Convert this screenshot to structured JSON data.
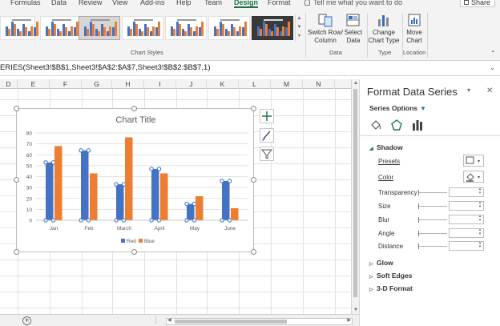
{
  "ribbon": {
    "tabs": [
      {
        "label": "Formulas",
        "active": false
      },
      {
        "label": "Data",
        "active": false
      },
      {
        "label": "Review",
        "active": false
      },
      {
        "label": "View",
        "active": false
      },
      {
        "label": "Add-ins",
        "active": false
      },
      {
        "label": "Help",
        "active": false
      },
      {
        "label": "Team",
        "active": false
      },
      {
        "label": "Design",
        "active": true
      },
      {
        "label": "Format",
        "active": false
      }
    ],
    "tell_me": "Tell me what you want to do",
    "share": "Share",
    "chart_styles_label": "Chart Styles",
    "data_group_label": "Data",
    "type_group_label": "Type",
    "location_group_label": "Location",
    "switch_row_column": [
      "Switch Row/",
      "Column"
    ],
    "select_data": [
      "Select",
      "Data"
    ],
    "change_chart_type": [
      "Change",
      "Chart Type"
    ],
    "move_chart": [
      "Move",
      "Chart"
    ]
  },
  "formula_bar": {
    "formula": "ERIES(Sheet3!$B$1,Sheet3!$A$2:$A$7,Sheet3!$B$2:$B$7,1)"
  },
  "columns": [
    "D",
    "E",
    "F",
    "G",
    "H",
    "I",
    "J",
    "K",
    "L",
    "M",
    "N"
  ],
  "colors": {
    "accent": "#217346",
    "series_red": "#4472c4",
    "series_blue": "#ed7d31",
    "selection_blue": "#2f6fc6"
  },
  "chart_data": {
    "type": "bar",
    "title": "Chart Title",
    "categories": [
      "Jan",
      "Feb",
      "March",
      "April",
      "May",
      "June"
    ],
    "series": [
      {
        "name": "Red",
        "values": [
          53,
          64,
          33,
          47,
          15,
          36
        ]
      },
      {
        "name": "Blue",
        "values": [
          68,
          43,
          76,
          43,
          22,
          11
        ]
      }
    ],
    "ylim": [
      0,
      80
    ],
    "yticks": [
      0,
      10,
      20,
      30,
      40,
      50,
      60,
      70,
      80
    ],
    "grid": true,
    "legend_position": "bottom",
    "selected_series": "Red"
  },
  "pane": {
    "title": "Format Data Series",
    "series_options": "Series Options",
    "shadow": "Shadow",
    "presets": "Presets",
    "color": "Color",
    "transparency": "Transparency",
    "size": "Size",
    "blur": "Blur",
    "angle": "Angle",
    "distance": "Distance",
    "glow": "Glow",
    "soft_edges": "Soft Edges",
    "three_d_format": "3-D Format"
  },
  "icons": {
    "close": "close-icon",
    "pin": "pane-options-icon",
    "fill": "fill-line-icon",
    "effects": "effects-pentagon-icon",
    "series_opts": "series-options-bars-icon",
    "add_element": "plus-icon",
    "brush": "brush-icon",
    "filter": "filter-icon"
  }
}
